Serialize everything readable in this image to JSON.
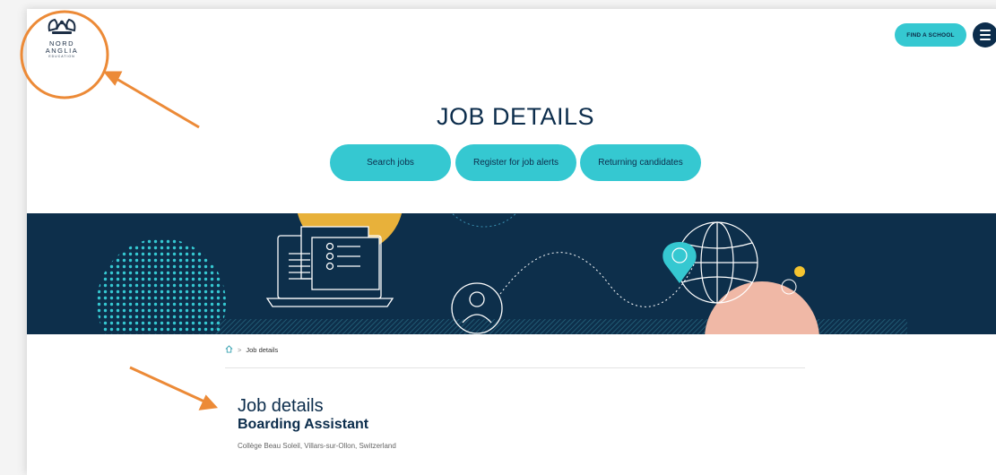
{
  "header": {
    "logo": {
      "line1": "NORD",
      "line2": "ANGLIA",
      "line3": "EDUCATION"
    },
    "find_school_label": "FIND A SCHOOL",
    "menu_icon": "hamburger-menu-icon"
  },
  "hero": {
    "title": "JOB DETAILS",
    "buttons": [
      {
        "label": "Search jobs"
      },
      {
        "label": "Register for job alerts"
      },
      {
        "label": "Returning candidates"
      }
    ]
  },
  "breadcrumb": {
    "home_icon": "home-icon",
    "separator": ">",
    "current": "Job details"
  },
  "job": {
    "heading": "Job details",
    "title": "Boarding Assistant",
    "location": "Collège Beau Soleil, Villars-sur-Ollon, Switzerland"
  },
  "colors": {
    "navy": "#0c2d4c",
    "teal": "#35c8d1",
    "banner": "#0d2f4b",
    "yellow": "#e8b13a",
    "salmon": "#f0b8a6",
    "annotation": "#ec8a37"
  }
}
